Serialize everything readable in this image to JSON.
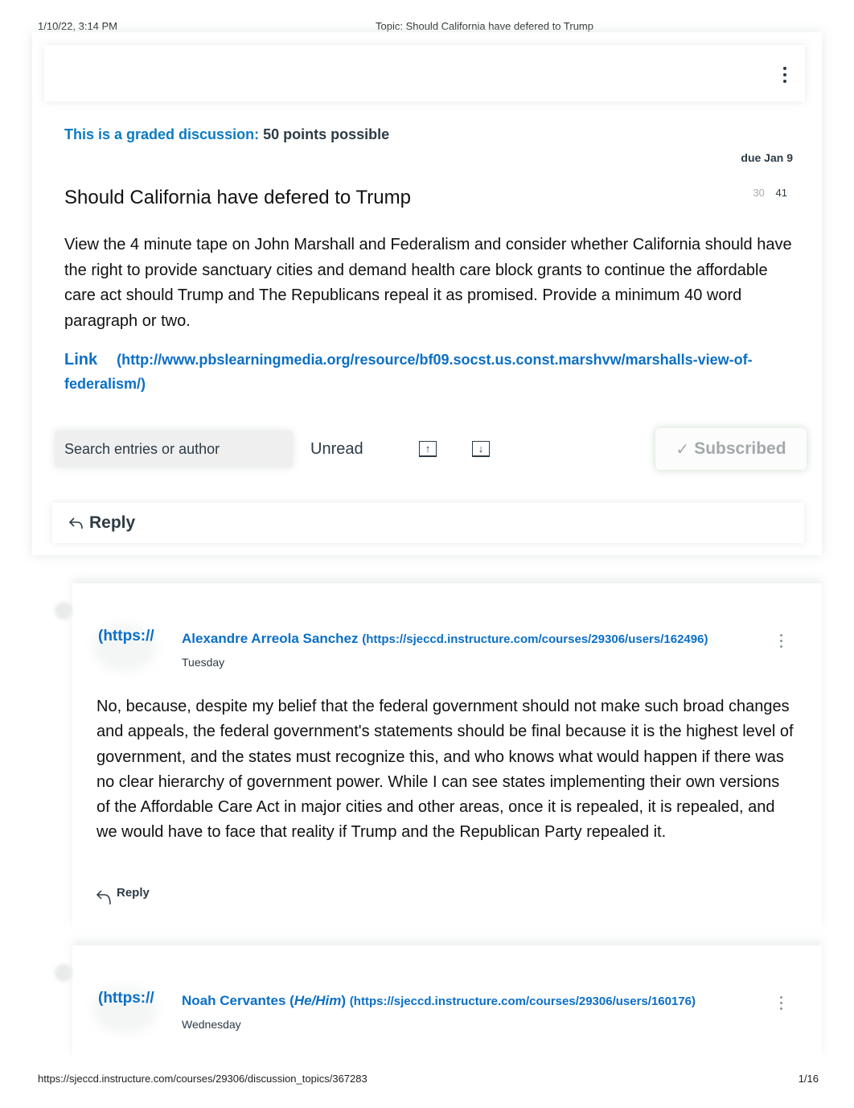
{
  "print_header": {
    "datetime": "1/10/22, 3:14 PM",
    "title": "Topic: Should California have defered to Trump"
  },
  "print_footer": {
    "url": "https://sjeccd.instructure.com/courses/29306/discussion_topics/367283",
    "page": "1/16"
  },
  "topic": {
    "graded_label": "This is a graded discussion:",
    "points": "50 points possible",
    "due": "due Jan 9",
    "unread_count": "30",
    "total_count": "41",
    "title": "Should California have defered to Trump",
    "body": "View the 4 minute tape on John Marshall and Federalism and consider whether California should have the right to provide sanctuary cities and demand health care block grants to continue the affordable care act should Trump and The Republicans repeal it as promised. Provide a minimum 40 word paragraph or two.",
    "link_label": "Link",
    "link_url": "(http://www.pbslearningmedia.org/resource/bf09.socst.us.const.marshvw/marshalls-view-of-federalism/)"
  },
  "toolbar": {
    "search_placeholder": "Search entries or author",
    "unread_label": "Unread",
    "sort_up_icon": "arrow-up-box",
    "sort_down_icon": "arrow-down-box",
    "subscribed_label": "Subscribed",
    "subscribed_icon": "checkmark"
  },
  "reply_label": "Reply",
  "entries": [
    {
      "avatar_text": "(https://",
      "author": "Alexandre Arreola Sanchez",
      "pronouns": "",
      "author_url": "(https://sjeccd.instructure.com/courses/29306/users/162496)",
      "date": "Tuesday",
      "body": "No, because, despite my belief that the federal government should not make such broad changes and appeals, the federal government's statements should be final because it is the highest level of government, and the states must recognize this, and who knows what would happen if there was no clear hierarchy of government power. While I can see states implementing their own versions of the Affordable Care Act in major cities and other areas, once it is repealed, it is repealed, and we would have to face that reality if Trump and the Republican Party repealed it.",
      "reply_label": "Reply"
    },
    {
      "avatar_text": "(https://",
      "author": "Noah Cervantes",
      "pronouns": "He/Him",
      "author_url": "(https://sjeccd.instructure.com/courses/29306/users/160176)",
      "date": "Wednesday"
    }
  ]
}
